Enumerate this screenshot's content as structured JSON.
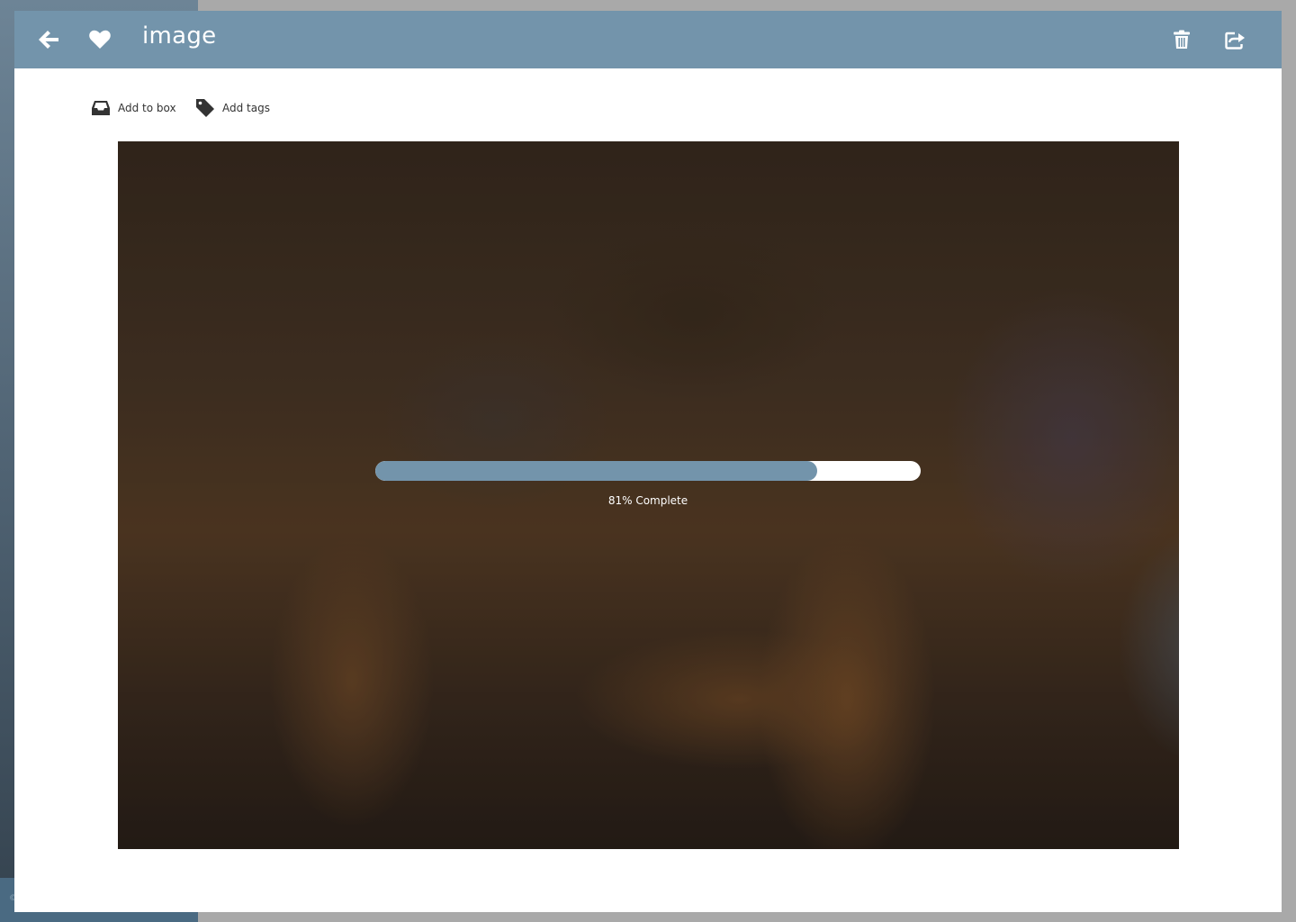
{
  "header": {
    "title": "image"
  },
  "icons": {
    "back": "back-arrow-icon",
    "favorite": "heart-icon",
    "delete": "trash-icon",
    "share": "share-icon",
    "box": "inbox-icon",
    "tags": "tag-icon"
  },
  "actions": {
    "add_to_box": "Add to box",
    "add_tags": "Add tags"
  },
  "upload": {
    "progress_percent": 81,
    "progress_label": "81% Complete"
  },
  "colors": {
    "accent": "#7394ab",
    "background": "#a9a9a9",
    "panel": "#ffffff"
  }
}
